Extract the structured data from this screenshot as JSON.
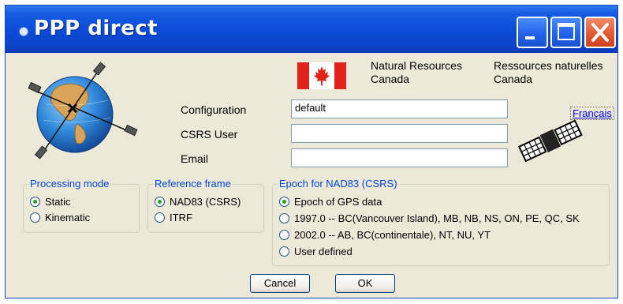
{
  "window": {
    "title": "PPP direct"
  },
  "titlebar": {
    "minimize_icon": "minimize-icon",
    "maximize_icon": "maximize-icon",
    "close_icon": "close-icon"
  },
  "header": {
    "org_en_line1": "Natural Resources",
    "org_en_line2": "Canada",
    "org_fr_line1": "Ressources naturelles",
    "org_fr_line2": "Canada",
    "language_link": "Français",
    "flag_icon": "canada-flag-icon",
    "globe_icon": "globe-satellites-icon",
    "satellite_icon": "satellite-icon"
  },
  "form": {
    "configuration_label": "Configuration",
    "configuration_value": "default",
    "csrs_user_label": "CSRS User",
    "csrs_user_value": "",
    "email_label": "Email",
    "email_value": ""
  },
  "processing_mode": {
    "title": "Processing mode",
    "options": [
      "Static",
      "Kinematic"
    ],
    "selected": "Static"
  },
  "reference_frame": {
    "title": "Reference frame",
    "options": [
      "NAD83 (CSRS)",
      "ITRF"
    ],
    "selected": "NAD83 (CSRS)"
  },
  "epoch": {
    "title": "Epoch for NAD83 (CSRS)",
    "options": [
      "Epoch of GPS data",
      "1997.0 -- BC(Vancouver Island), MB, NB, NS, ON, PE, QC, SK",
      "2002.0 -- AB, BC(continentale), NT, NU, YT",
      "User defined"
    ],
    "selected": "Epoch of GPS data"
  },
  "buttons": {
    "cancel": "Cancel",
    "ok": "OK"
  },
  "colors": {
    "titlebar": "#0a4bd8",
    "background": "#ece9d8",
    "group_title": "#0046d5",
    "flag_red": "#e2231a"
  }
}
